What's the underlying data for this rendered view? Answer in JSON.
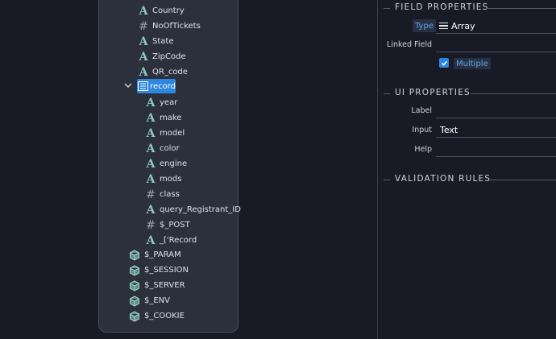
{
  "tree": {
    "items": [
      {
        "label": "Country",
        "icon": "text-icon"
      },
      {
        "label": "NoOfTickets",
        "icon": "number-icon"
      },
      {
        "label": "State",
        "icon": "text-icon"
      },
      {
        "label": "ZipCode",
        "icon": "text-icon"
      },
      {
        "label": "QR_code",
        "icon": "text-icon"
      }
    ],
    "record": {
      "label": "record",
      "icon": "array-icon",
      "expanded": true,
      "selected": true
    },
    "record_children": [
      {
        "label": "year",
        "icon": "text-icon"
      },
      {
        "label": "make",
        "icon": "text-icon"
      },
      {
        "label": "model",
        "icon": "text-icon"
      },
      {
        "label": "color",
        "icon": "text-icon"
      },
      {
        "label": "engine",
        "icon": "text-icon"
      },
      {
        "label": "mods",
        "icon": "text-icon"
      },
      {
        "label": "class",
        "icon": "number-icon"
      },
      {
        "label": "query_Registrant_ID",
        "icon": "text-icon"
      },
      {
        "label": "$_POST",
        "icon": "number-icon"
      },
      {
        "label": "_['Record",
        "icon": "text-icon"
      }
    ],
    "globals": [
      {
        "label": "$_PARAM",
        "icon": "cube-icon"
      },
      {
        "label": "$_SESSION",
        "icon": "cube-icon"
      },
      {
        "label": "$_SERVER",
        "icon": "cube-icon"
      },
      {
        "label": "$_ENV",
        "icon": "cube-icon"
      },
      {
        "label": "$_COOKIE",
        "icon": "cube-icon"
      }
    ]
  },
  "field_properties": {
    "title": "FIELD PROPERTIES",
    "type_label": "Type",
    "type_value": "Array",
    "linked_field_label": "Linked Field",
    "linked_field_value": "",
    "multiple_label": "Multiple",
    "multiple_checked": true
  },
  "ui_properties": {
    "title": "UI PROPERTIES",
    "label_label": "Label",
    "label_value": "",
    "input_label": "Input",
    "input_value": "Text",
    "help_label": "Help",
    "help_value": ""
  },
  "validation_rules": {
    "title": "VALIDATION RULES"
  },
  "colors": {
    "background": "#181a26",
    "panel": "#2c2f3c",
    "accent": "#2d86df",
    "icon_teal": "#8ec9c2"
  }
}
